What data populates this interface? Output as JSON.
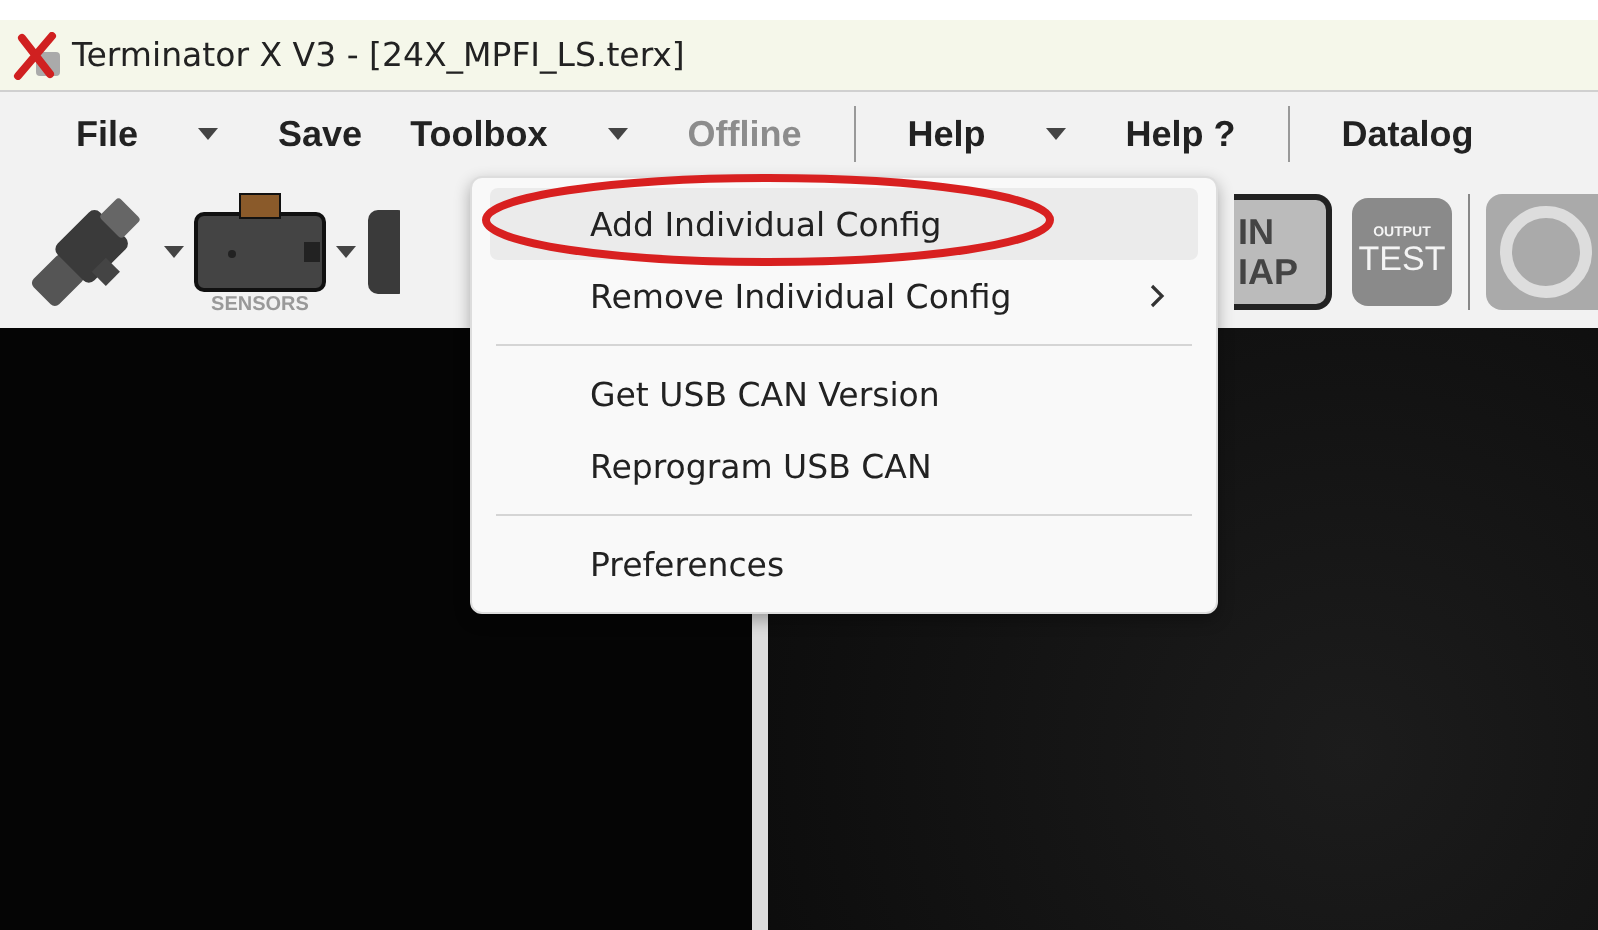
{
  "window": {
    "title": "Terminator X V3 - [24X_MPFI_LS.terx]"
  },
  "menu_bar": [
    {
      "label": "File",
      "kind": "menu",
      "disabled": false
    },
    {
      "kind": "dropdown"
    },
    {
      "label": "Save",
      "kind": "menu",
      "disabled": false
    },
    {
      "label": "Toolbox",
      "kind": "menu",
      "disabled": false
    },
    {
      "kind": "dropdown"
    },
    {
      "label": "Offline",
      "kind": "menu",
      "disabled": true
    },
    {
      "kind": "separator"
    },
    {
      "label": "Help",
      "kind": "menu",
      "disabled": false
    },
    {
      "kind": "dropdown"
    },
    {
      "label": "Help ?",
      "kind": "menu",
      "disabled": false
    },
    {
      "kind": "separator"
    },
    {
      "label": "Datalog",
      "kind": "menu",
      "disabled": false
    }
  ],
  "toolbar": [
    {
      "kind": "injector"
    },
    {
      "kind": "sensors",
      "label": "SENSORS"
    },
    {
      "kind": "partial"
    },
    {
      "kind": "pin_map",
      "lines": [
        "IN",
        "IAP"
      ]
    },
    {
      "kind": "output_test",
      "lines": [
        "OUTPUT",
        "TEST"
      ]
    },
    {
      "kind": "gauge"
    }
  ],
  "dropdown_menu": {
    "items": [
      {
        "kind": "item",
        "label": "Add Individual Config",
        "selected": true,
        "circled": true,
        "submenu": false
      },
      {
        "kind": "item",
        "label": "Remove Individual Config",
        "selected": false,
        "circled": false,
        "submenu": true
      },
      {
        "kind": "separator"
      },
      {
        "kind": "item",
        "label": "Get USB CAN Version",
        "selected": false,
        "circled": false,
        "submenu": false
      },
      {
        "kind": "item",
        "label": "Reprogram USB CAN",
        "selected": false,
        "circled": false,
        "submenu": false
      },
      {
        "kind": "separator"
      },
      {
        "kind": "item",
        "label": "Preferences",
        "selected": false,
        "circled": false,
        "submenu": false
      }
    ]
  }
}
